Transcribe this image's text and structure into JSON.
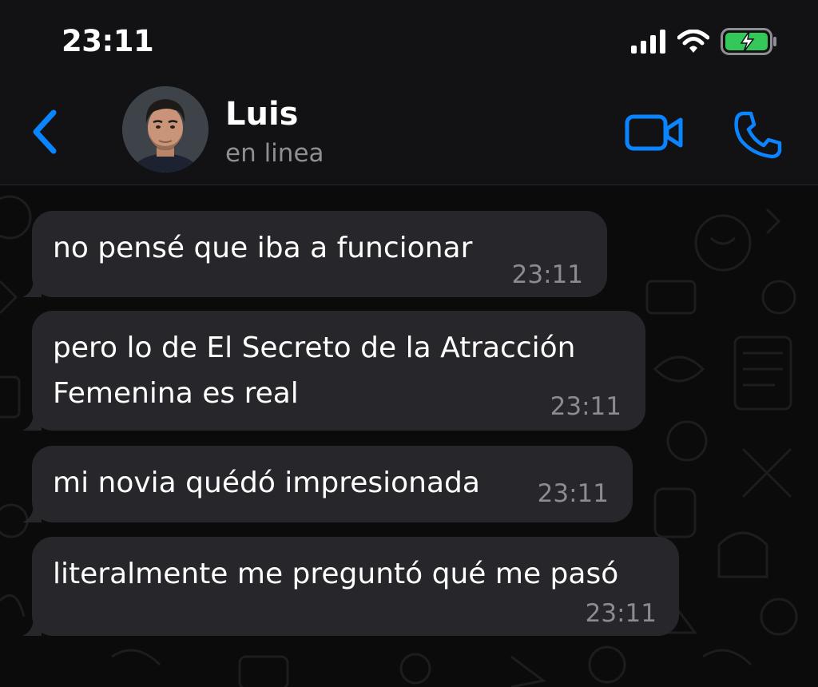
{
  "status_bar": {
    "time": "23:11",
    "icons": [
      "cellular-signal-icon",
      "wifi-icon",
      "battery-charging-icon"
    ],
    "battery_color": "#34c759"
  },
  "nav": {
    "back_icon": "chevron-left-icon",
    "contact_name": "Luis",
    "contact_status": "en linea",
    "video_icon": "video-camera-icon",
    "call_icon": "phone-icon",
    "accent_color": "#0a84ff"
  },
  "messages": [
    {
      "text": "no pensé que iba a funcionar",
      "time": "23:11"
    },
    {
      "text": "pero lo de El Secreto de la Atracción\nFemenina es real",
      "time": "23:11"
    },
    {
      "text": "mi novia quédó impresionada",
      "time": "23:11"
    },
    {
      "text": "literalmente me preguntó qué me pasó",
      "time": "23:11"
    }
  ],
  "colors": {
    "bubble_incoming": "#26262b",
    "chat_background": "#0b0b0c",
    "header_background": "#121214",
    "secondary_text": "#8e8e93"
  }
}
